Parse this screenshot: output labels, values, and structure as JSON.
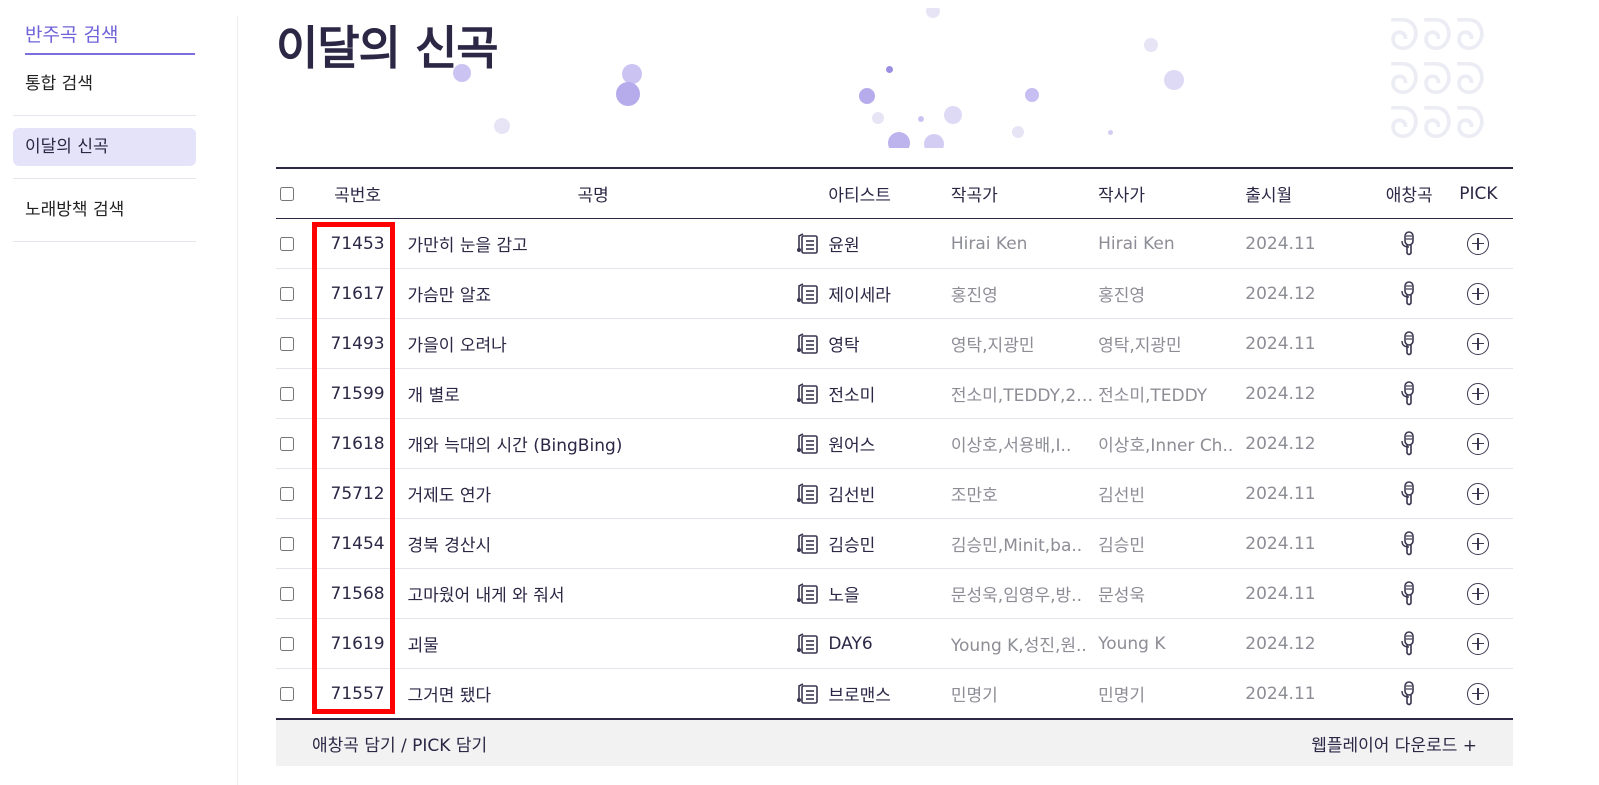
{
  "sidebar": {
    "heading": "반주곡 검색",
    "items": [
      {
        "label": "통합 검색"
      },
      {
        "label": "이달의 신곡"
      },
      {
        "label": "노래방책 검색"
      }
    ]
  },
  "page": {
    "title": "이달의 신곡"
  },
  "table": {
    "headers": {
      "number": "곡번호",
      "title": "곡명",
      "artist": "아티스트",
      "composer": "작곡가",
      "lyricist": "작사가",
      "date": "출시월",
      "favorite": "애창곡",
      "pick": "PICK"
    },
    "rows": [
      {
        "number": "71453",
        "title": "가만히 눈을 감고",
        "artist": "윤원",
        "composer": "Hirai Ken",
        "lyricist": "Hirai Ken",
        "date": "2024.11"
      },
      {
        "number": "71617",
        "title": "가슴만 알죠",
        "artist": "제이세라",
        "composer": "홍진영",
        "lyricist": "홍진영",
        "date": "2024.12"
      },
      {
        "number": "71493",
        "title": "가을이 오려나",
        "artist": "영탁",
        "composer": "영탁,지광민",
        "lyricist": "영탁,지광민",
        "date": "2024.11"
      },
      {
        "number": "71599",
        "title": "개 별로",
        "artist": "전소미",
        "composer": "전소미,TEDDY,2…",
        "lyricist": "전소미,TEDDY",
        "date": "2024.12"
      },
      {
        "number": "71618",
        "title": "개와 늑대의 시간 (BingBing)",
        "artist": "원어스",
        "composer": "이상호,서용배,I..",
        "lyricist": "이상호,Inner Ch..",
        "date": "2024.12"
      },
      {
        "number": "75712",
        "title": "거제도 연가",
        "artist": "김선빈",
        "composer": "조만호",
        "lyricist": "김선빈",
        "date": "2024.11"
      },
      {
        "number": "71454",
        "title": "경북 경산시",
        "artist": "김승민",
        "composer": "김승민,Minit,ba..",
        "lyricist": "김승민",
        "date": "2024.11"
      },
      {
        "number": "71568",
        "title": "고마웠어 내게 와 줘서",
        "artist": "노을",
        "composer": "문성욱,임영우,방..",
        "lyricist": "문성욱",
        "date": "2024.11"
      },
      {
        "number": "71619",
        "title": "괴물",
        "artist": "DAY6",
        "composer": "Young K,성진,원..",
        "lyricist": "Young K",
        "date": "2024.12"
      },
      {
        "number": "71557",
        "title": "그거면 됐다",
        "artist": "브로맨스",
        "composer": "민명기",
        "lyricist": "민명기",
        "date": "2024.11"
      }
    ]
  },
  "footer": {
    "left": "애창곡 담기 / PICK 담기",
    "right": "웹플레이어 다운로드 +"
  },
  "icons": {
    "lyrics": "lyrics-sheet-icon",
    "favorite": "microphone-icon",
    "pick": "plus-circle-icon"
  },
  "colors": {
    "accent": "#6f63d9",
    "active_bg": "#e5e3fa",
    "highlight": "#ff0000",
    "text": "#2b2745",
    "muted": "#8d8d96"
  }
}
